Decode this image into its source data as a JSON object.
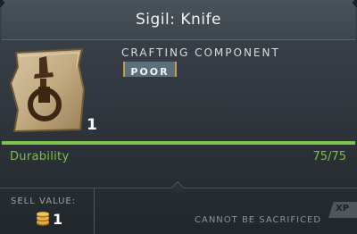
{
  "item": {
    "title": "Sigil: Knife",
    "category": "CRAFTING COMPONENT",
    "rarity": "POOR",
    "count": "1",
    "icon": "sigil-knife-parchment-icon"
  },
  "durability": {
    "label": "Durability",
    "value_text": "75/75",
    "current": 75,
    "max": 75
  },
  "footer": {
    "sell_label": "SELL VALUE:",
    "sell_amount": "1",
    "coin_icon": "coin-stack-icon",
    "sacrifice_text": "CANNOT BE SACRIFICED",
    "xp_badge": "XP"
  },
  "colors": {
    "durability_green": "#7dbf48",
    "rarity_bg": "#5c6f7b",
    "rarity_border": "#c89a4c"
  }
}
